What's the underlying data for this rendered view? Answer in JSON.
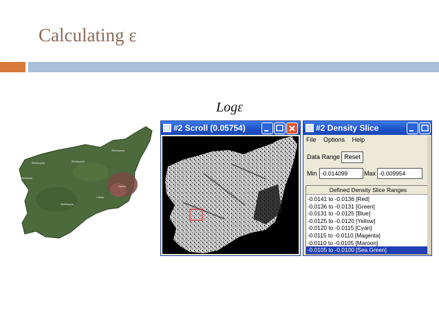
{
  "slide": {
    "title": "Calculating ε",
    "sub_label": "Logε"
  },
  "left_map": {
    "place_labels": [
      "Shekhupura",
      "Shekhupura",
      "Shekhupura",
      "Shekhupura",
      "Lahore",
      "Lahore",
      "Shekhupura"
    ]
  },
  "scroll_window": {
    "title": "#2 Scroll (0.05754)"
  },
  "density_slice": {
    "title": "#2 Density Slice",
    "menu": [
      "File",
      "Options",
      "Help"
    ],
    "data_range_label": "Data Range",
    "reset_label": "Reset",
    "min_label": "Min",
    "min_value": "-0.014099",
    "max_label": "Max",
    "max_value": "-0.009954",
    "ranges_header": "Defined Density Slice Ranges",
    "ranges": [
      "-0.0141 to -0.0136 [Red]",
      "-0.0136 to -0.0131 [Green]",
      "-0.0131 to -0.0125 [Blue]",
      "-0.0125 to -0.0120 [Yellow]",
      "-0.0120 to -0.0115 [Cyan]",
      "-0.0115 to -0.0110 [Magenta]",
      "-0.0110 to -0.0105 [Maroon]",
      "-0.0105 to -0.0100 [Sea Green]"
    ],
    "selected_index": 7
  },
  "colors": {
    "title_text": "#8a6a58",
    "accent_bar": "#d87a3c",
    "main_bar": "#a8bfd8",
    "titlebar": "#1d50c8",
    "selected_row": "#1f3fb3",
    "map_green": "#4c6a3c"
  }
}
